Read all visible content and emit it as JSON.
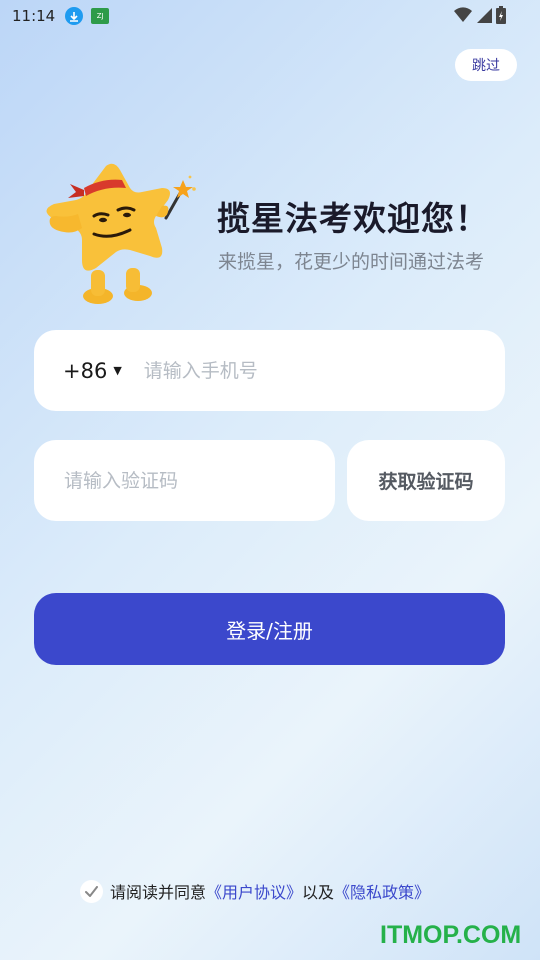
{
  "status_bar": {
    "time": "11:14",
    "app_icon_text": "ZJ"
  },
  "header": {
    "skip_label": "跳过"
  },
  "welcome": {
    "title": "揽星法考欢迎您！",
    "subtitle": "来揽星，花更少的时间通过法考"
  },
  "form": {
    "country_code": "+86",
    "phone_placeholder": "请输入手机号",
    "code_placeholder": "请输入验证码",
    "get_code_label": "获取验证码",
    "submit_label": "登录/注册"
  },
  "agreement": {
    "prefix": "请阅读并同意",
    "user_agreement": "《用户协议》",
    "connector": "以及",
    "privacy_policy": "《隐私政策》"
  },
  "watermark": "ITMOP.COM",
  "colors": {
    "accent": "#3b48cc",
    "watermark": "#25b14a",
    "mascot": "#f9c13a"
  }
}
